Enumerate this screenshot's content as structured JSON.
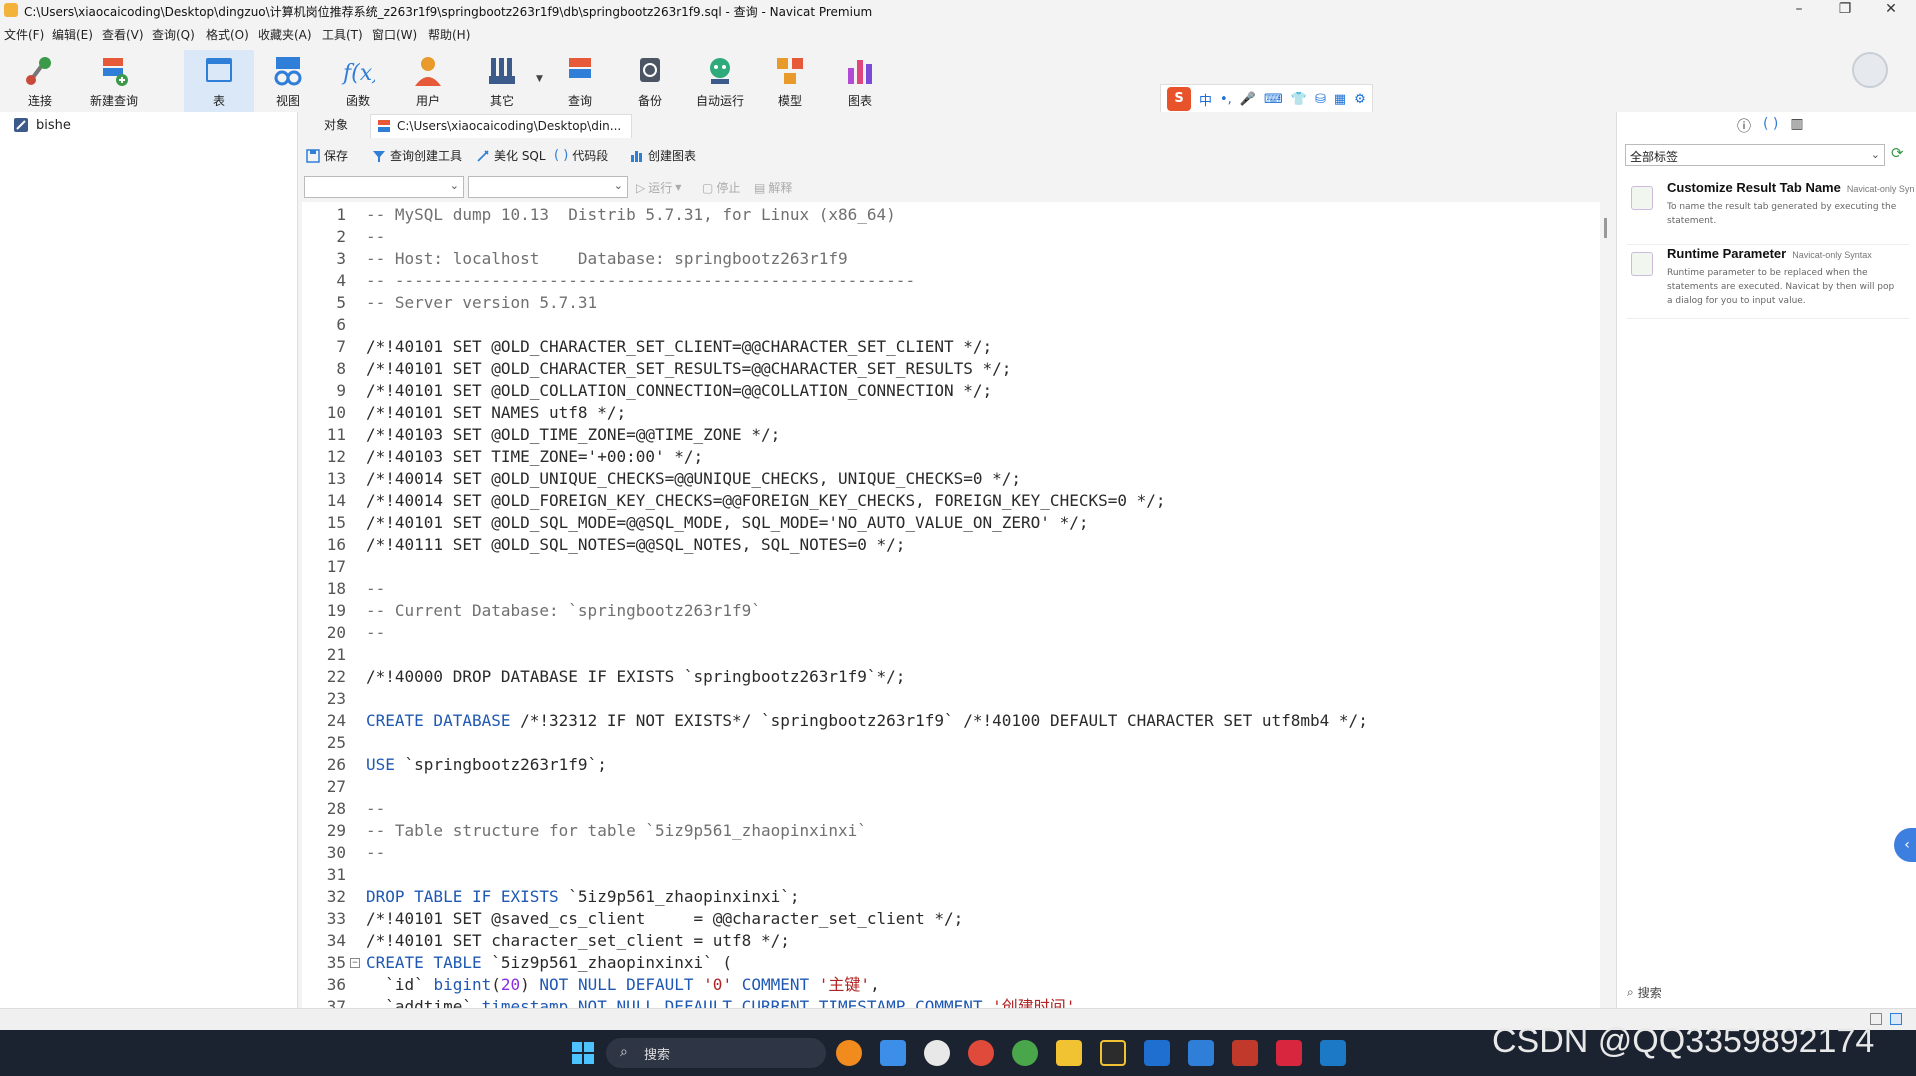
{
  "window": {
    "title": "C:\\Users\\xiaocaicoding\\Desktop\\dingzuo\\计算机岗位推荐系统_z263r1f9\\springbootz263r1f9\\db\\springbootz263r1f9.sql - 查询 - Navicat Premium",
    "minimize": "–",
    "restore": "❐",
    "close": "✕"
  },
  "menu": [
    "文件(F)",
    "编辑(E)",
    "查看(V)",
    "查询(Q)",
    "格式(O)",
    "收藏夹(A)",
    "工具(T)",
    "窗口(W)",
    "帮助(H)"
  ],
  "toolbar": [
    {
      "label": "连接",
      "icon": "connection-icon",
      "color": "#3a9a4a"
    },
    {
      "label": "新建查询",
      "icon": "new-query-icon",
      "color": "#e65a3a"
    },
    {
      "label": "表",
      "icon": "table-icon",
      "color": "#2f7ed8"
    },
    {
      "label": "视图",
      "icon": "view-icon",
      "color": "#2f7ed8"
    },
    {
      "label": "函数",
      "icon": "function-icon",
      "color": "#2f7ed8"
    },
    {
      "label": "用户",
      "icon": "user-icon",
      "color": "#e89a2a"
    },
    {
      "label": "其它",
      "icon": "other-icon",
      "color": "#3c5a8a"
    },
    {
      "label": "查询",
      "icon": "query-icon",
      "color": "#e65a3a"
    },
    {
      "label": "备份",
      "icon": "backup-icon",
      "color": "#4b5563"
    },
    {
      "label": "自动运行",
      "icon": "automation-icon",
      "color": "#2faa7a"
    },
    {
      "label": "模型",
      "icon": "model-icon",
      "color": "#e89a2a"
    },
    {
      "label": "图表",
      "icon": "chart-icon",
      "color": "#b14bd6"
    }
  ],
  "connection": {
    "name": "bishe"
  },
  "tabs": {
    "objects": "对象",
    "query": "C:\\Users\\xiaocaicoding\\Desktop\\din..."
  },
  "query_toolbar": {
    "save": "保存",
    "builder": "查询创建工具",
    "beautify": "美化 SQL",
    "snippet": "代码段",
    "create_chart": "创建图表",
    "run": "运行",
    "stop": "停止",
    "explain": "解释"
  },
  "editor": {
    "lines": [
      [
        {
          "t": "-- MySQL dump 10.13  Distrib 5.7.31, for Linux (x86_64)",
          "c": "com"
        }
      ],
      [
        {
          "t": "--",
          "c": "com"
        }
      ],
      [
        {
          "t": "-- Host: localhost    Database: springbootz263r1f9",
          "c": "com"
        }
      ],
      [
        {
          "t": "-- ------------------------------------------------------",
          "c": "com"
        }
      ],
      [
        {
          "t": "-- Server version 5.7.31",
          "c": "com"
        }
      ],
      [],
      [
        {
          "t": "/*!40101 SET @OLD_CHARACTER_SET_CLIENT=@@CHARACTER_SET_CLIENT */;",
          "c": "txt"
        }
      ],
      [
        {
          "t": "/*!40101 SET @OLD_CHARACTER_SET_RESULTS=@@CHARACTER_SET_RESULTS */;",
          "c": "txt"
        }
      ],
      [
        {
          "t": "/*!40101 SET @OLD_COLLATION_CONNECTION=@@COLLATION_CONNECTION */;",
          "c": "txt"
        }
      ],
      [
        {
          "t": "/*!40101 SET NAMES utf8 */;",
          "c": "txt"
        }
      ],
      [
        {
          "t": "/*!40103 SET @OLD_TIME_ZONE=@@TIME_ZONE */;",
          "c": "txt"
        }
      ],
      [
        {
          "t": "/*!40103 SET TIME_ZONE='+00:00' */;",
          "c": "txt"
        }
      ],
      [
        {
          "t": "/*!40014 SET @OLD_UNIQUE_CHECKS=@@UNIQUE_CHECKS, UNIQUE_CHECKS=0 */;",
          "c": "txt"
        }
      ],
      [
        {
          "t": "/*!40014 SET @OLD_FOREIGN_KEY_CHECKS=@@FOREIGN_KEY_CHECKS, FOREIGN_KEY_CHECKS=0 */;",
          "c": "txt"
        }
      ],
      [
        {
          "t": "/*!40101 SET @OLD_SQL_MODE=@@SQL_MODE, SQL_MODE='NO_AUTO_VALUE_ON_ZERO' */;",
          "c": "txt"
        }
      ],
      [
        {
          "t": "/*!40111 SET @OLD_SQL_NOTES=@@SQL_NOTES, SQL_NOTES=0 */;",
          "c": "txt"
        }
      ],
      [],
      [
        {
          "t": "--",
          "c": "com"
        }
      ],
      [
        {
          "t": "-- Current Database: `springbootz263r1f9`",
          "c": "com"
        }
      ],
      [
        {
          "t": "--",
          "c": "com"
        }
      ],
      [],
      [
        {
          "t": "/*!40000 DROP DATABASE IF EXISTS `springbootz263r1f9`*/;",
          "c": "txt"
        }
      ],
      [],
      [
        {
          "t": "CREATE DATABASE",
          "c": "kw"
        },
        {
          "t": " /*!32312 IF NOT EXISTS*/ `springbootz263r1f9` /*!40100 DEFAULT CHARACTER SET utf8mb4 */;",
          "c": "txt"
        }
      ],
      [],
      [
        {
          "t": "USE",
          "c": "kw"
        },
        {
          "t": " `springbootz263r1f9`;",
          "c": "txt"
        }
      ],
      [],
      [
        {
          "t": "--",
          "c": "com"
        }
      ],
      [
        {
          "t": "-- Table structure for table `5iz9p561_zhaopinxinxi`",
          "c": "com"
        }
      ],
      [
        {
          "t": "--",
          "c": "com"
        }
      ],
      [],
      [
        {
          "t": "DROP TABLE IF EXISTS",
          "c": "kw"
        },
        {
          "t": " `5iz9p561_zhaopinxinxi`;",
          "c": "txt"
        }
      ],
      [
        {
          "t": "/*!40101 SET @saved_cs_client     = @@character_set_client */;",
          "c": "txt"
        }
      ],
      [
        {
          "t": "/*!40101 SET character_set_client = utf8 */;",
          "c": "txt"
        }
      ],
      [
        {
          "t": "CREATE TABLE",
          "c": "kw"
        },
        {
          "t": " `5iz9p561_zhaopinxinxi` (",
          "c": "txt"
        }
      ],
      [
        {
          "t": "  `id` ",
          "c": "txt"
        },
        {
          "t": "bigint",
          "c": "kw"
        },
        {
          "t": "(",
          "c": "txt"
        },
        {
          "t": "20",
          "c": "num"
        },
        {
          "t": ") ",
          "c": "txt"
        },
        {
          "t": "NOT NULL DEFAULT",
          "c": "kw"
        },
        {
          "t": " ",
          "c": "txt"
        },
        {
          "t": "'0'",
          "c": "str"
        },
        {
          "t": " ",
          "c": "txt"
        },
        {
          "t": "COMMENT",
          "c": "kw"
        },
        {
          "t": " ",
          "c": "txt"
        },
        {
          "t": "'主键'",
          "c": "str"
        },
        {
          "t": ",",
          "c": "txt"
        }
      ],
      [
        {
          "t": "  `addtime` ",
          "c": "txt"
        },
        {
          "t": "timestamp NOT NULL DEFAULT CURRENT_TIMESTAMP COMMENT",
          "c": "kw"
        },
        {
          "t": " ",
          "c": "txt"
        },
        {
          "t": "'创建时间'",
          "c": "str"
        }
      ]
    ]
  },
  "right_panel": {
    "filter": "全部标签",
    "snippets": [
      {
        "title": "Customize Result Tab Name",
        "tag": "Navicat-only Syn",
        "desc": "To name the result tab generated by executing the statement."
      },
      {
        "title": "Runtime Parameter",
        "tag": "Navicat-only Syntax",
        "desc": "Runtime parameter to be replaced when the statements are executed. Navicat by then will pop a dialog for you to input value."
      }
    ],
    "search": "搜索"
  },
  "ime": [
    "中",
    "•,",
    "🎤",
    "⌨",
    "👕",
    "⛁",
    "▦",
    "⚙"
  ],
  "taskbar": {
    "search": "搜索"
  },
  "watermark": "CSDN @QQ3359892174",
  "colors": {
    "accent": "#2f7ed8",
    "keyword": "#1f58b3",
    "comment": "#707070",
    "string": "#b22222"
  }
}
